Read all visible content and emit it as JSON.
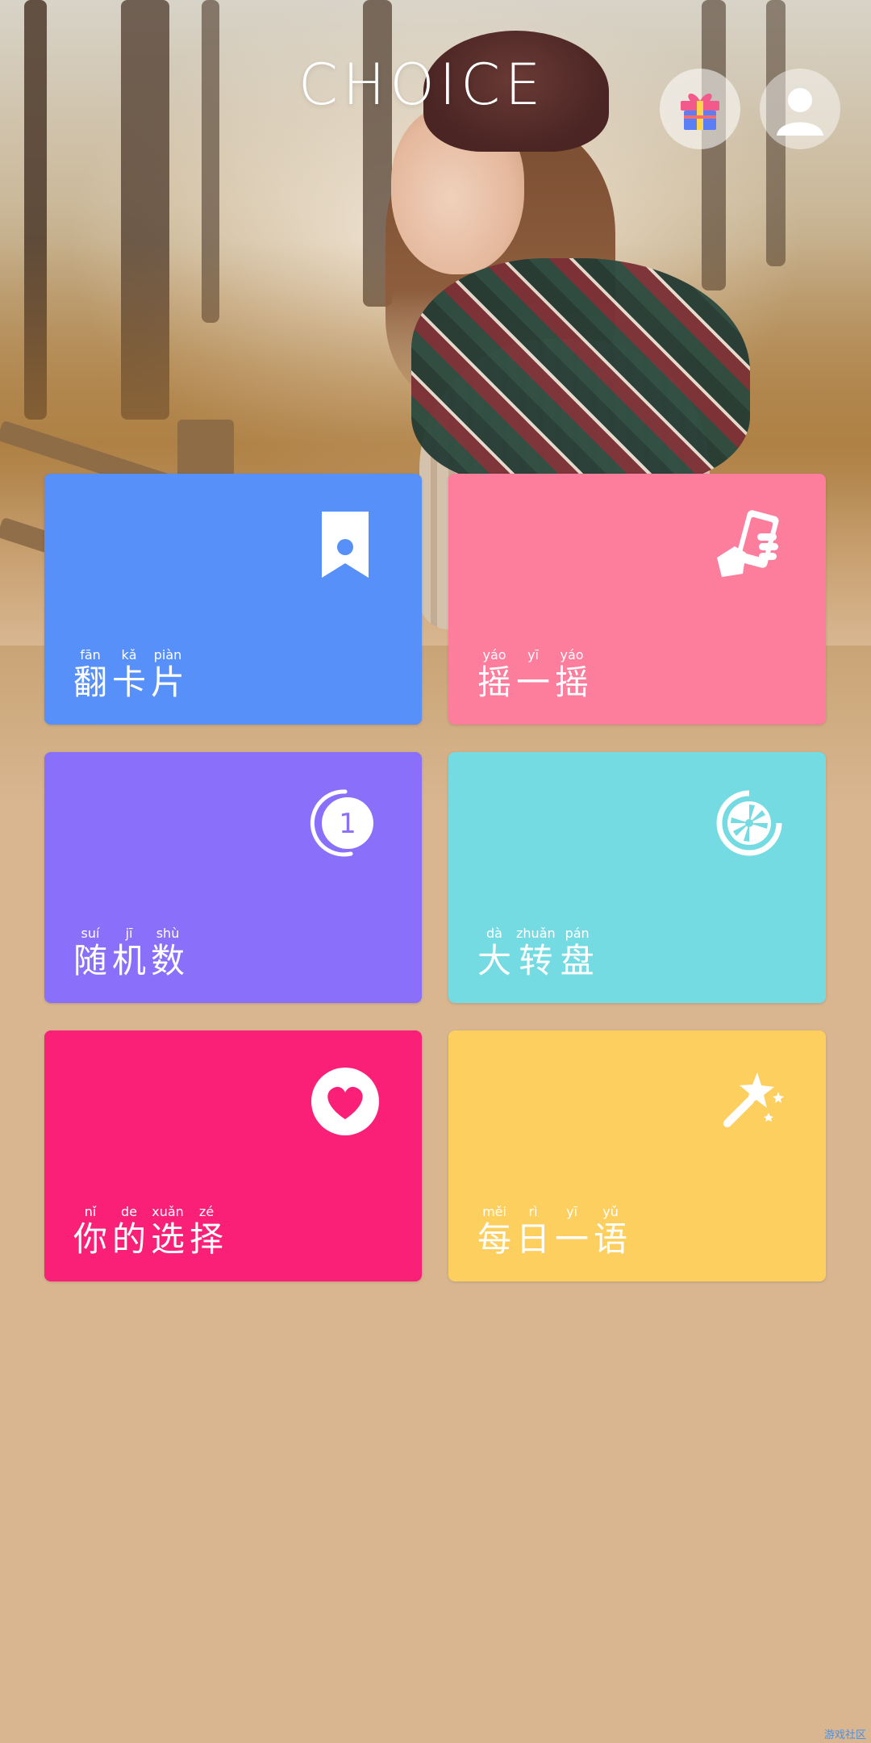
{
  "header": {
    "logo": "CHOICE",
    "gift_icon": "gift-icon",
    "profile_icon": "user-avatar-icon"
  },
  "tiles": [
    {
      "id": "flip-card",
      "color": "#5790f9",
      "icon": "bookmark-icon",
      "chars": [
        {
          "py": "fān",
          "hz": "翻"
        },
        {
          "py": "kǎ",
          "hz": "卡"
        },
        {
          "py": "piàn",
          "hz": "片"
        }
      ]
    },
    {
      "id": "shake",
      "color": "#fd7d9d",
      "icon": "hand-phone-icon",
      "chars": [
        {
          "py": "yáo",
          "hz": "摇"
        },
        {
          "py": "yī",
          "hz": "一"
        },
        {
          "py": "yáo",
          "hz": "摇"
        }
      ]
    },
    {
      "id": "random-number",
      "color": "#8a6ffb",
      "icon": "number-one-icon",
      "icon_text": "1",
      "chars": [
        {
          "py": "suí",
          "hz": "随"
        },
        {
          "py": "jī",
          "hz": "机"
        },
        {
          "py": "shù",
          "hz": "数"
        }
      ]
    },
    {
      "id": "wheel",
      "color": "#74dbe2",
      "icon": "spin-wheel-icon",
      "chars": [
        {
          "py": "dà",
          "hz": "大"
        },
        {
          "py": "zhuǎn",
          "hz": "转"
        },
        {
          "py": "pán",
          "hz": "盘"
        }
      ]
    },
    {
      "id": "your-choice",
      "color": "#fb2077",
      "icon": "heart-icon",
      "chars": [
        {
          "py": "nǐ",
          "hz": "你"
        },
        {
          "py": "de",
          "hz": "的"
        },
        {
          "py": "xuǎn",
          "hz": "选"
        },
        {
          "py": "zé",
          "hz": "择"
        }
      ]
    },
    {
      "id": "daily-quote",
      "color": "#fdcf5f",
      "icon": "magic-wand-icon",
      "chars": [
        {
          "py": "měi",
          "hz": "每"
        },
        {
          "py": "rì",
          "hz": "日"
        },
        {
          "py": "yī",
          "hz": "一"
        },
        {
          "py": "yǔ",
          "hz": "语"
        }
      ]
    }
  ],
  "watermark": "游戏社区"
}
